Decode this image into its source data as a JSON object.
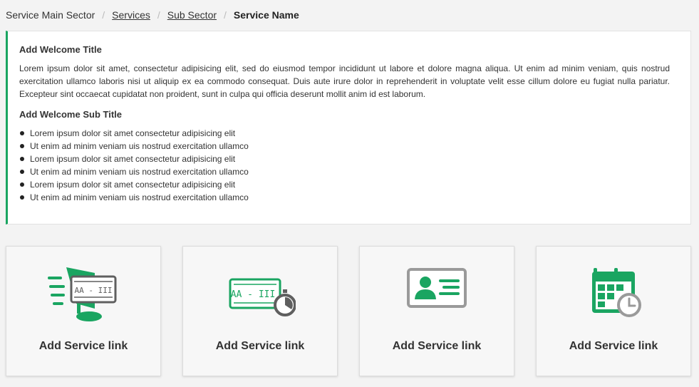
{
  "breadcrumb": {
    "items": [
      "Service Main Sector",
      "Services",
      "Sub Sector",
      "Service Name"
    ],
    "separator": "/"
  },
  "welcome": {
    "title": "Add Welcome Title",
    "paragraph": "Lorem ipsum dolor sit amet, consectetur adipisicing elit, sed do eiusmod tempor incididunt ut labore et dolore magna aliqua. Ut enim ad minim veniam, quis nostrud exercitation ullamco laboris nisi ut aliquip ex ea commodo consequat. Duis aute irure dolor in reprehenderit in voluptate velit esse cillum dolore eu fugiat nulla pariatur. Excepteur sint occaecat cupidatat non proident, sunt in culpa qui officia deserunt mollit anim id est laborum.",
    "subtitle": "Add Welcome Sub Title",
    "list": [
      "Lorem ipsum dolor sit amet consectetur adipisicing elit",
      "Ut enim ad minim veniam uis nostrud exercitation ullamco",
      "Lorem ipsum dolor sit amet consectetur adipisicing elit",
      "Ut enim ad minim veniam uis nostrud exercitation ullamco",
      "Lorem ipsum dolor sit amet consectetur adipisicing elit",
      "Ut enim ad minim veniam uis nostrud exercitation ullamco"
    ]
  },
  "services": [
    {
      "label": "Add Service link",
      "icon": "plate-monitor-icon",
      "plate_text": "AA - III"
    },
    {
      "label": "Add Service link",
      "icon": "plate-timer-icon",
      "plate_text": "AA - III"
    },
    {
      "label": "Add Service link",
      "icon": "id-card-icon"
    },
    {
      "label": "Add Service link",
      "icon": "calendar-clock-icon"
    }
  ],
  "colors": {
    "accent": "#1aa561",
    "icon_gray": "#5f5f5f",
    "icon_light_gray": "#9a9a9a"
  }
}
